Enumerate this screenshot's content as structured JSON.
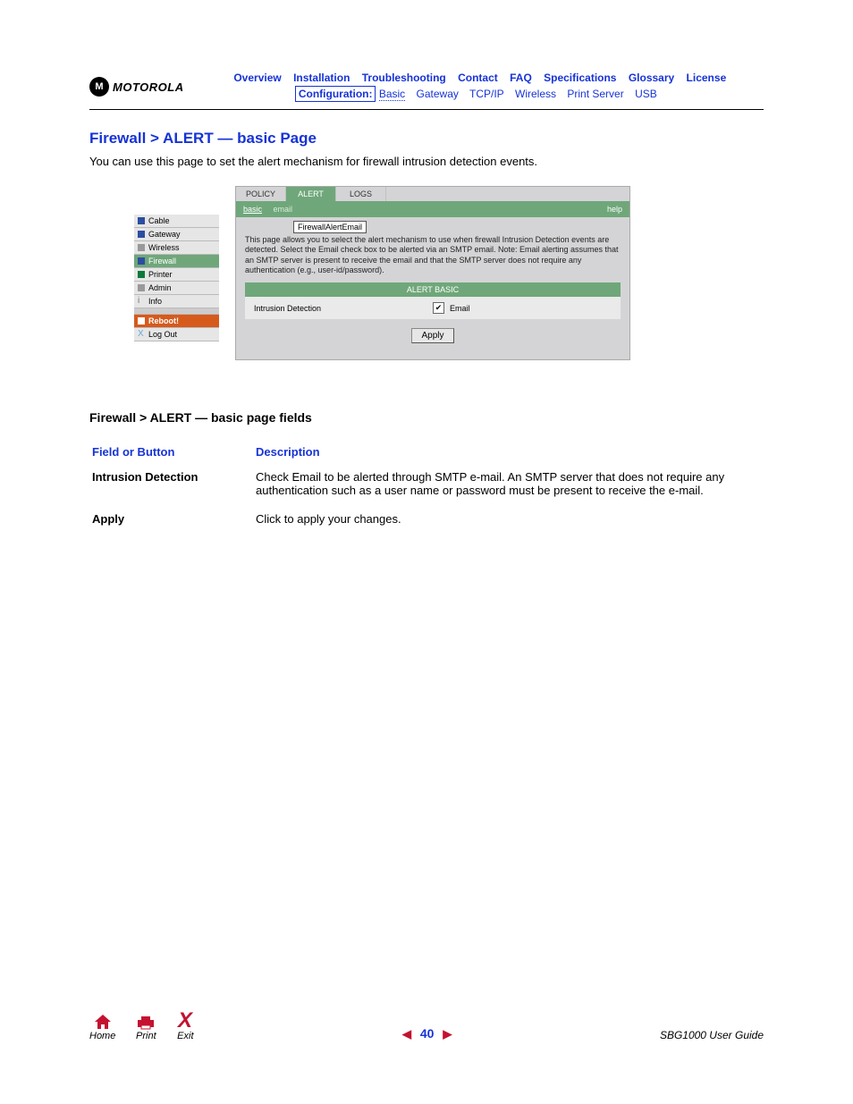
{
  "logo_text": "MOTOROLA",
  "logo_glyph": "M",
  "nav_top": [
    "Overview",
    "Installation",
    "Troubleshooting",
    "Contact",
    "FAQ",
    "Specifications",
    "Glossary",
    "License"
  ],
  "nav_conf_label": "Configuration:",
  "nav_conf_items": [
    "Basic",
    "Gateway",
    "TCP/IP",
    "Wireless",
    "Print Server",
    "USB"
  ],
  "page_title": "Firewall > ALERT — basic Page",
  "intro": "You can use this page to set the alert mechanism for firewall intrusion detection events.",
  "sidebar": [
    "Cable",
    "Gateway",
    "Wireless",
    "Firewall",
    "Printer",
    "Admin",
    "Info"
  ],
  "sidebar_reboot": "Reboot!",
  "sidebar_logout": "Log Out",
  "tabs": [
    "POLICY",
    "ALERT",
    "LOGS"
  ],
  "subtabs": {
    "active": "basic",
    "other": "email"
  },
  "help": "help",
  "panel_title": "FirewallAlertEmail",
  "panel_desc": "This page allows you to select the alert mechanism to use when firewall Intrusion Detection events are detected. Select the Email check box to be alerted via an SMTP email. Note: Email alerting assumes that an SMTP server is present to receive the email and that the SMTP server does not require any authentication (e.g., user-id/password).",
  "ab_head": "ALERT BASIC",
  "ab_left": "Intrusion Detection",
  "ab_cb_label": "Email",
  "apply": "Apply",
  "fields_title": "Firewall > ALERT — basic page fields",
  "ft_col1": "Field or Button",
  "ft_col2": "Description",
  "ft_r1_a": "Intrusion Detection",
  "ft_r1_b": "Check Email to be alerted through SMTP e-mail. An SMTP server that does not require any authentication such as a user name or password must be present to receive the e-mail.",
  "ft_r2_a": "Apply",
  "ft_r2_b": "Click to apply your changes.",
  "footer": {
    "home": "Home",
    "print": "Print",
    "exit": "Exit",
    "page": "40",
    "guide": "SBG1000 User Guide"
  }
}
